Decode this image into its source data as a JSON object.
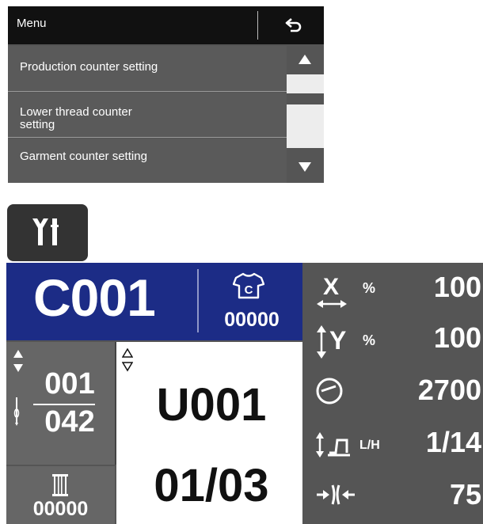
{
  "menu": {
    "title": "Menu",
    "items": [
      {
        "label_lines": [
          "Production counter setting"
        ]
      },
      {
        "label_lines": [
          "Lower thread counter",
          "setting"
        ]
      },
      {
        "label_lines": [
          "Garment counter setting"
        ]
      }
    ]
  },
  "icons": {
    "back": "return-arrow-icon",
    "scroll_up": "triangle-up-icon",
    "scroll_down": "triangle-down-icon",
    "settings": "tools-icon",
    "garment": "shirt-c-icon",
    "needle": "needle-icon",
    "bobbin": "bobbin-icon",
    "x_scale": "x-scale-icon",
    "y_scale": "y-scale-icon",
    "speed": "speed-gauge-icon",
    "presser": "presser-foot-lift-icon",
    "tension": "thread-tension-icon"
  },
  "status": {
    "pattern_code": "C001",
    "garment_count": "00000",
    "step_current": "001",
    "step_total": "042",
    "thread_count": "00000",
    "user_code": "U001",
    "user_page": "01/03"
  },
  "params": {
    "x_scale": {
      "unit": "%",
      "value": "100"
    },
    "y_scale": {
      "label": "Y",
      "unit": "%",
      "value": "100"
    },
    "speed": {
      "value": "2700"
    },
    "presser": {
      "unit": "L/H",
      "value": "1/14"
    },
    "tension": {
      "value": "75"
    }
  },
  "colors": {
    "pattern_bg": "#1c2c86",
    "panel_bg": "#555555",
    "menu_header_bg": "#111111"
  }
}
